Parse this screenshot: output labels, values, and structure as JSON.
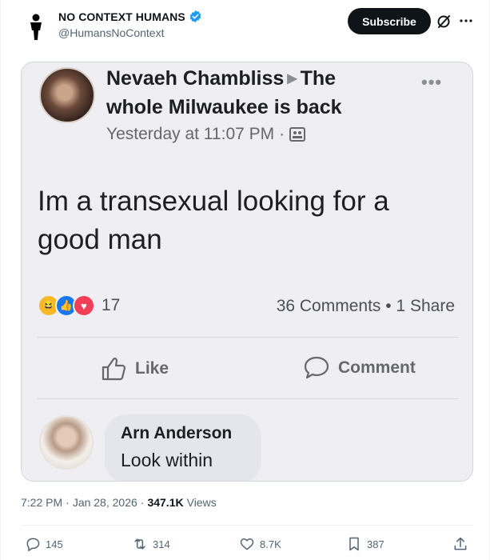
{
  "header": {
    "display_name": "NO CONTEXT HUMANS",
    "handle": "@HumansNoContext",
    "subscribe_label": "Subscribe",
    "icons": [
      "person-silhouette-icon",
      "verified-badge-icon",
      "grok-icon",
      "more-icon"
    ],
    "verified_color": "#1d9bf0"
  },
  "media": {
    "author_name": "Nevaeh Chambliss",
    "group_name": "The whole Milwaukee is back",
    "timestamp": "Yesterday at 11:07 PM",
    "more": "•••",
    "body": "Im a transexual looking for a good man",
    "reaction_count": "17",
    "comments_meta": "36 Comments • 1 Share",
    "like_label": "Like",
    "comment_label": "Comment",
    "commenter_name": "Arn Anderson",
    "comment_text": "Look within"
  },
  "meta": {
    "time": "7:22 PM",
    "date": "Jan 28, 2026",
    "views_count": "347.1K",
    "views_label": "Views"
  },
  "actions": {
    "replies": "145",
    "reposts": "314",
    "likes": "8.7K",
    "bookmarks": "387"
  }
}
